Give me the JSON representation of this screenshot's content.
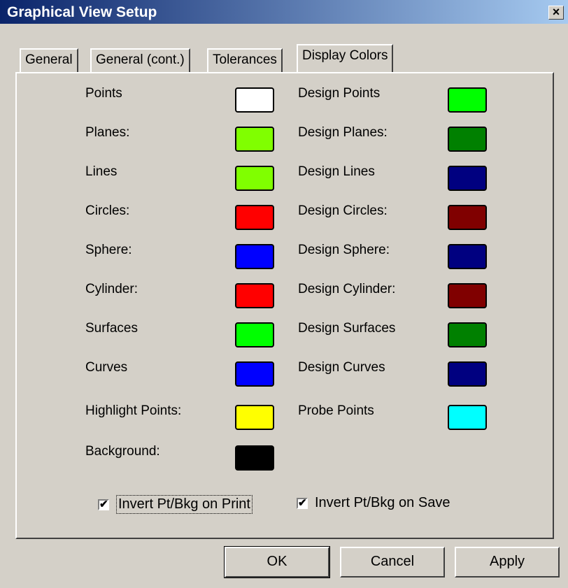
{
  "window": {
    "title": "Graphical View Setup",
    "close_glyph": "×"
  },
  "tabs": [
    {
      "label": "General"
    },
    {
      "label": "General (cont.)"
    },
    {
      "label": "Tolerances"
    },
    {
      "label": "Display Colors"
    }
  ],
  "colors": {
    "left": [
      {
        "label": "Points",
        "color": "#ffffff"
      },
      {
        "label": "Planes:",
        "color": "#80ff00"
      },
      {
        "label": "Lines",
        "color": "#80ff00"
      },
      {
        "label": "Circles:",
        "color": "#ff0000"
      },
      {
        "label": "Sphere:",
        "color": "#0000ff"
      },
      {
        "label": "Cylinder:",
        "color": "#ff0000"
      },
      {
        "label": "Surfaces",
        "color": "#00ff00"
      },
      {
        "label": "Curves",
        "color": "#0000ff"
      },
      {
        "label": "Highlight Points:",
        "color": "#ffff00"
      },
      {
        "label": "Background:",
        "color": "#000000"
      }
    ],
    "right": [
      {
        "label": "Design Points",
        "color": "#00ff00"
      },
      {
        "label": "Design Planes:",
        "color": "#008000"
      },
      {
        "label": "Design Lines",
        "color": "#000080"
      },
      {
        "label": "Design Circles:",
        "color": "#800000"
      },
      {
        "label": "Design Sphere:",
        "color": "#000080"
      },
      {
        "label": "Design Cylinder:",
        "color": "#800000"
      },
      {
        "label": "Design Surfaces",
        "color": "#008000"
      },
      {
        "label": "Design Curves",
        "color": "#000080"
      },
      {
        "label": "Probe Points",
        "color": "#00ffff"
      }
    ]
  },
  "options": {
    "invert_print": {
      "label": "Invert Pt/Bkg on Print",
      "checked": true
    },
    "invert_save": {
      "label": "Invert Pt/Bkg on Save",
      "checked": true
    }
  },
  "buttons": {
    "ok": "OK",
    "cancel": "Cancel",
    "apply": "Apply"
  }
}
